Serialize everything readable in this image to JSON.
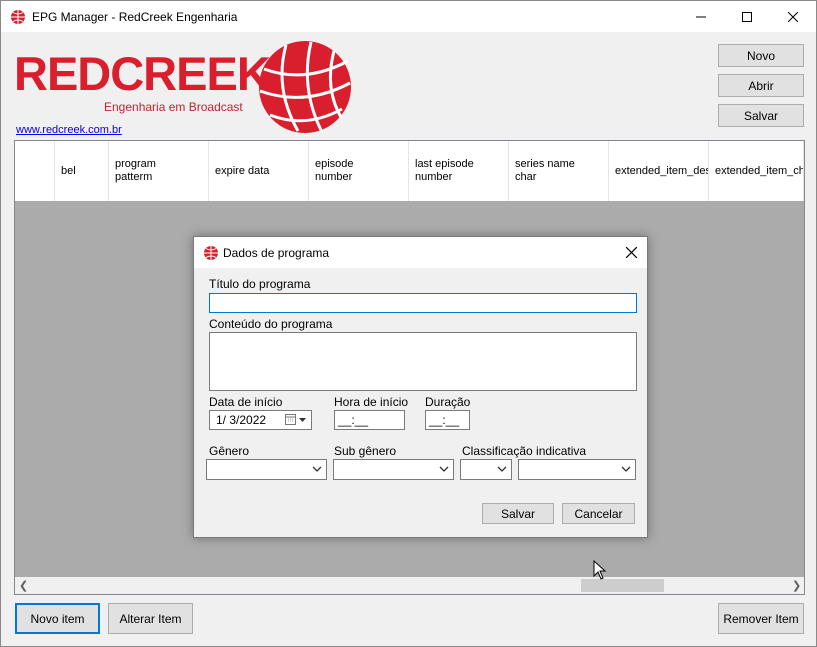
{
  "window": {
    "title": "EPG Manager - RedCreek Engenharia"
  },
  "brand": {
    "logo_text": "REDCREEK",
    "tagline": "Engenharia em Broadcast",
    "link": "www.redcreek.com.br",
    "color": "#d91f2e"
  },
  "toolbar": {
    "novo": "Novo",
    "abrir": "Abrir",
    "salvar": "Salvar"
  },
  "grid": {
    "columns": [
      "bel",
      "program\npatterm",
      "expire data",
      "episode\nnumber",
      "last episode\nnumber",
      "series name\nchar",
      "extended_item_des",
      "extended_item_cha"
    ]
  },
  "bottom": {
    "novo_item": "Novo item",
    "alterar_item": "Alterar Item",
    "remover_item": "Remover Item"
  },
  "dialog": {
    "title": "Dados de programa",
    "titulo_label": "Título do programa",
    "titulo_value": "",
    "conteudo_label": "Conteúdo do programa",
    "conteudo_value": "",
    "data_label": "Data de início",
    "data_value": "1/  3/2022",
    "hora_label": "Hora de início",
    "hora_value": "__:__",
    "duracao_label": "Duração",
    "duracao_value": "__:__",
    "genero_label": "Gênero",
    "genero_value": "",
    "subgenero_label": "Sub gênero",
    "subgenero_value": "",
    "classificacao_label": "Classificação indicativa",
    "salvar": "Salvar",
    "cancelar": "Cancelar"
  },
  "icons": {
    "app": "globe-icon",
    "minimize": "minimize-icon",
    "maximize": "maximize-icon",
    "close": "close-icon",
    "calendar": "calendar-icon"
  }
}
